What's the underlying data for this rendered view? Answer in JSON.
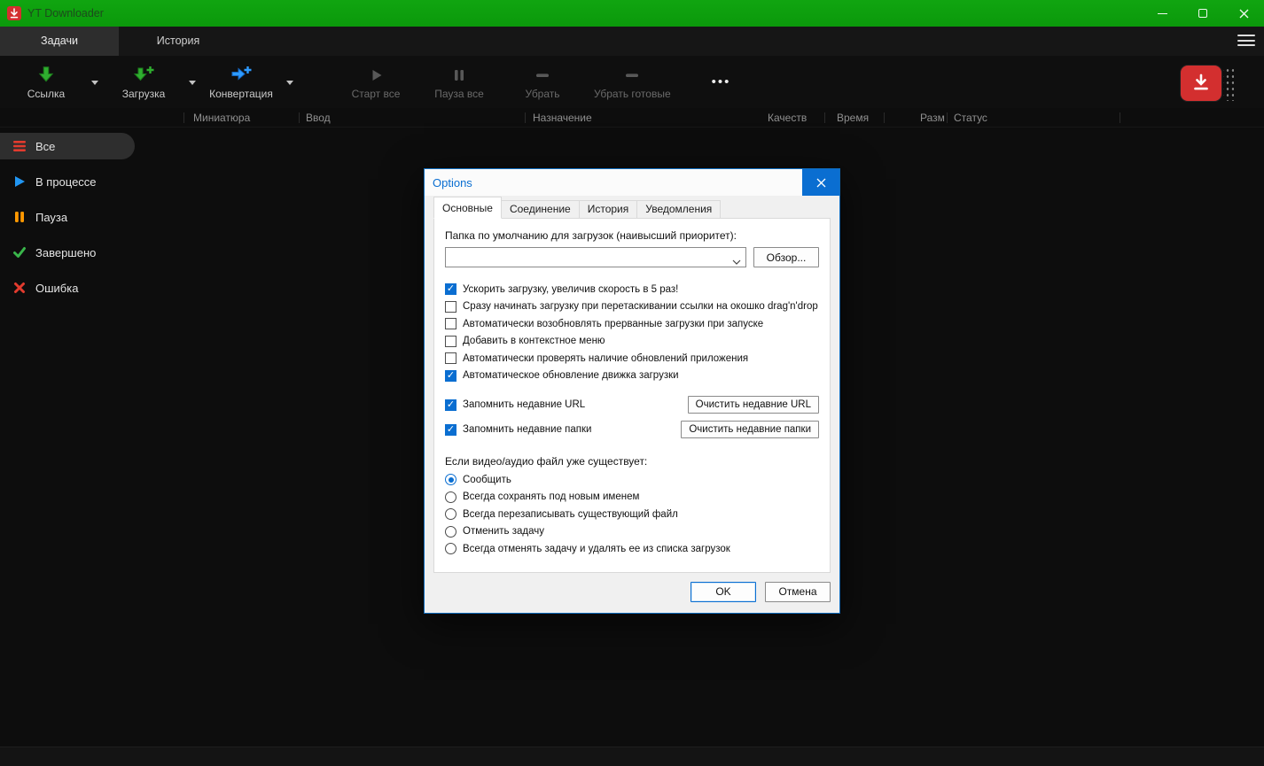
{
  "window": {
    "title": "YT Downloader"
  },
  "tabbar": {
    "tabs": [
      {
        "label": "Задачи",
        "active": true
      },
      {
        "label": "История",
        "active": false
      }
    ]
  },
  "toolbar": {
    "buttons": [
      {
        "label": "Ссылка",
        "icon": "link-download",
        "dropdown": true,
        "disabled": false
      },
      {
        "label": "Загрузка",
        "icon": "download-plus",
        "dropdown": true,
        "disabled": false
      },
      {
        "label": "Конвертация",
        "icon": "convert-plus",
        "dropdown": true,
        "disabled": false
      },
      {
        "label": "Старт все",
        "icon": "play",
        "dropdown": false,
        "disabled": true
      },
      {
        "label": "Пауза все",
        "icon": "pause",
        "dropdown": false,
        "disabled": true
      },
      {
        "label": "Убрать",
        "icon": "remove",
        "dropdown": false,
        "disabled": true
      },
      {
        "label": "Убрать готовые",
        "icon": "remove-done",
        "dropdown": false,
        "disabled": true
      }
    ],
    "more_label": "•••"
  },
  "columns": {
    "labels": [
      "Миниатюра",
      "Ввод",
      "Назначение",
      "Качеств",
      "Время",
      "Разм",
      "Статус"
    ]
  },
  "sidebar": {
    "items": [
      {
        "label": "Все",
        "icon": "list",
        "active": true
      },
      {
        "label": "В процессе",
        "icon": "play",
        "active": false
      },
      {
        "label": "Пауза",
        "icon": "pause",
        "active": false
      },
      {
        "label": "Завершено",
        "icon": "check",
        "active": false
      },
      {
        "label": "Ошибка",
        "icon": "error",
        "active": false
      }
    ]
  },
  "dialog": {
    "title": "Options",
    "tabs": [
      {
        "label": "Основные",
        "active": true
      },
      {
        "label": "Соединение",
        "active": false
      },
      {
        "label": "История",
        "active": false
      },
      {
        "label": "Уведомления",
        "active": false
      }
    ],
    "folder_label": "Папка по умолчанию для загрузок (наивысший приоритет):",
    "folder_value": "",
    "browse_label": "Обзор...",
    "checkboxes": [
      {
        "label": "Ускорить загрузку, увеличив скорость в 5 раз!",
        "checked": true
      },
      {
        "label": "Сразу начинать загрузку при перетаскивании ссылки на окошко drag'n'drop",
        "checked": false
      },
      {
        "label": "Автоматически возобновлять прерванные загрузки при запуске",
        "checked": false
      },
      {
        "label": "Добавить в контекстное меню",
        "checked": false
      },
      {
        "label": "Автоматически проверять наличие обновлений приложения",
        "checked": false
      },
      {
        "label": "Автоматическое обновление движка загрузки",
        "checked": true
      }
    ],
    "recent": [
      {
        "label": "Запомнить недавние URL",
        "checked": true,
        "button_label": "Очистить недавние URL"
      },
      {
        "label": "Запомнить недавние папки",
        "checked": true,
        "button_label": "Очистить недавние папки"
      }
    ],
    "exists_label": "Если видео/аудио файл уже существует:",
    "radios": [
      {
        "label": "Сообщить",
        "selected": true
      },
      {
        "label": "Всегда сохранять под новым именем",
        "selected": false
      },
      {
        "label": "Всегда перезаписывать существующий файл",
        "selected": false
      },
      {
        "label": "Отменить задачу",
        "selected": false
      },
      {
        "label": "Всегда отменять задачу и удалять ее из списка загрузок",
        "selected": false
      }
    ],
    "ok_label": "OK",
    "cancel_label": "Отмена"
  },
  "colors": {
    "titlebar_green": "#0b9e0b",
    "accent_blue": "#0a6ed1",
    "danger_red": "#d32f2f",
    "icon_green": "#2fae2f",
    "icon_blue": "#2e9bff",
    "icon_orange": "#ff9800"
  }
}
